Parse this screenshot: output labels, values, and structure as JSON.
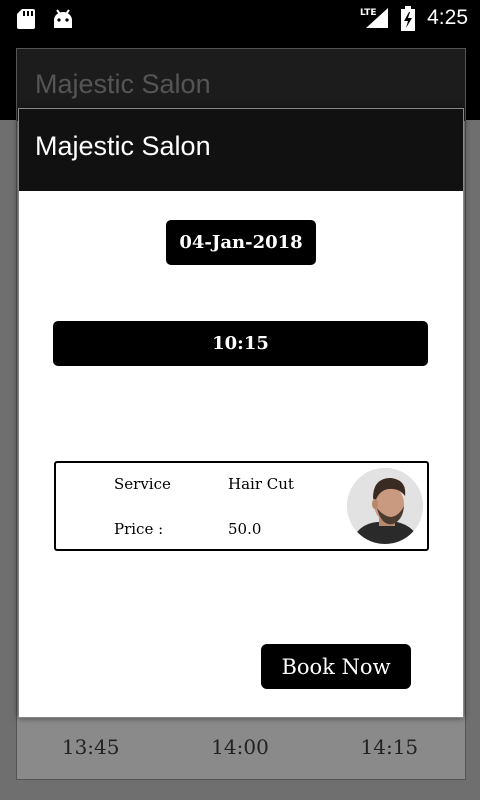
{
  "status_bar": {
    "time": "4:25",
    "network": "LTE",
    "icons": [
      "sd-card-icon",
      "android-icon",
      "signal-icon",
      "battery-icon"
    ]
  },
  "background": {
    "title": "Majestic Salon",
    "time_slots": [
      "13:45",
      "14:00",
      "14:15"
    ]
  },
  "dialog": {
    "title": "Majestic Salon",
    "date": "04-Jan-2018",
    "time": "10:15",
    "service": {
      "service_label": "Service",
      "service_value": "Hair Cut",
      "price_label": "Price :",
      "price_value": "50.0",
      "image": "man-haircut-avatar"
    },
    "book_button": "Book Now"
  },
  "colors": {
    "header": "#111111",
    "button": "#000000",
    "dialog_bg": "#ffffff",
    "scrim": "#6f6f6f"
  }
}
